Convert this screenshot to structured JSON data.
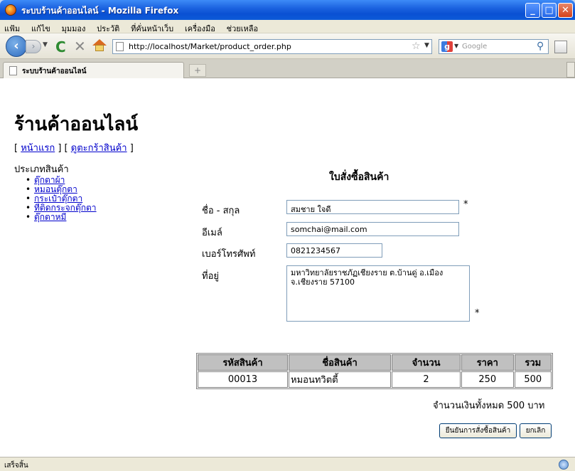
{
  "window": {
    "title": "ระบบร้านค้าออนไลน์ - Mozilla Firefox"
  },
  "menu": [
    "แฟ้ม",
    "แก้ไข",
    "มุมมอง",
    "ประวัติ",
    "ที่คั่นหน้าเว็บ",
    "เครื่องมือ",
    "ช่วยเหลือ"
  ],
  "toolbar": {
    "url": "http://localhost/Market/product_order.php",
    "search_placeholder": "Google"
  },
  "tab": {
    "label": "ระบบร้านค้าออนไลน์"
  },
  "page": {
    "heading": "ร้านค้าออนไลน์",
    "nav": {
      "open1": "[ ",
      "home": "หน้าแรก",
      "mid": " ] [ ",
      "cart": "ดูตะกร้าสินค้า",
      "close": " ]"
    },
    "categories_title": "ประเภทสินค้า",
    "categories": [
      "ตุ๊กตาผ้า",
      "หมอนตุ๊กตา",
      "กระเป๋าตุ๊กตา",
      "ที่ติดกระจกตุ๊กตา",
      "ตุ๊กตาหมี"
    ]
  },
  "form": {
    "title": "ใบสั่งซื้อสินค้า",
    "name_label": "ชื่อ - สกุล",
    "name_value": "สมชาย ใจดี",
    "email_label": "อีเมล์",
    "email_value": "somchai@mail.com",
    "phone_label": "เบอร์โทรศัพท์",
    "phone_value": "0821234567",
    "address_label": "ที่อยู่",
    "address_line1": "มหาวิทยาลัยราชภัฏเชียงราย  ต.บ้านดู่  อ.เมือง",
    "address_line2": "จ.เชียงราย  57100",
    "required_mark": "*"
  },
  "order_table": {
    "headers": [
      "รหัสสินค้า",
      "ชื่อสินค้า",
      "จำนวน",
      "ราคา",
      "รวม"
    ],
    "rows": [
      [
        "00013",
        "หมอนทวิตตี้",
        "2",
        "250",
        "500"
      ]
    ]
  },
  "total_text": "จำนวนเงินทั้งหมด 500 บาท",
  "buttons": {
    "confirm": "ยืนยันการสั่งซื้อสินค้า",
    "cancel": "ยกเลิก"
  },
  "status": {
    "text": "เสร็จสิ้น"
  }
}
